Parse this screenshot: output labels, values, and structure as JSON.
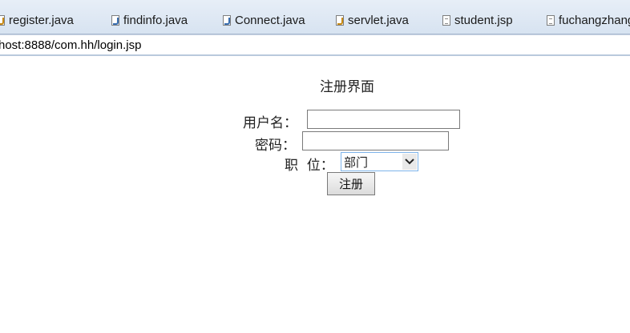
{
  "tabs": [
    {
      "label": "register.java",
      "icon": "java-file-icon"
    },
    {
      "label": "findinfo.java",
      "icon": "java-file-icon"
    },
    {
      "label": "Connect.java",
      "icon": "java-file-icon"
    },
    {
      "label": "servlet.java",
      "icon": "java-file-icon"
    },
    {
      "label": "student.jsp",
      "icon": "jsp-file-icon"
    },
    {
      "label": "fuchangzhang",
      "icon": "jsp-file-icon"
    }
  ],
  "address": {
    "url": "host:8888/com.hh/login.jsp"
  },
  "form": {
    "title": "注册界面",
    "username_label": "用户名：",
    "username_value": "",
    "password_label": "密码：",
    "password_value": "",
    "position_label": "职  位：",
    "position_selected": "部门",
    "submit_label": "注册"
  },
  "colors": {
    "tab_bar": "#dce6f2",
    "select_border": "#7eb4ea"
  }
}
